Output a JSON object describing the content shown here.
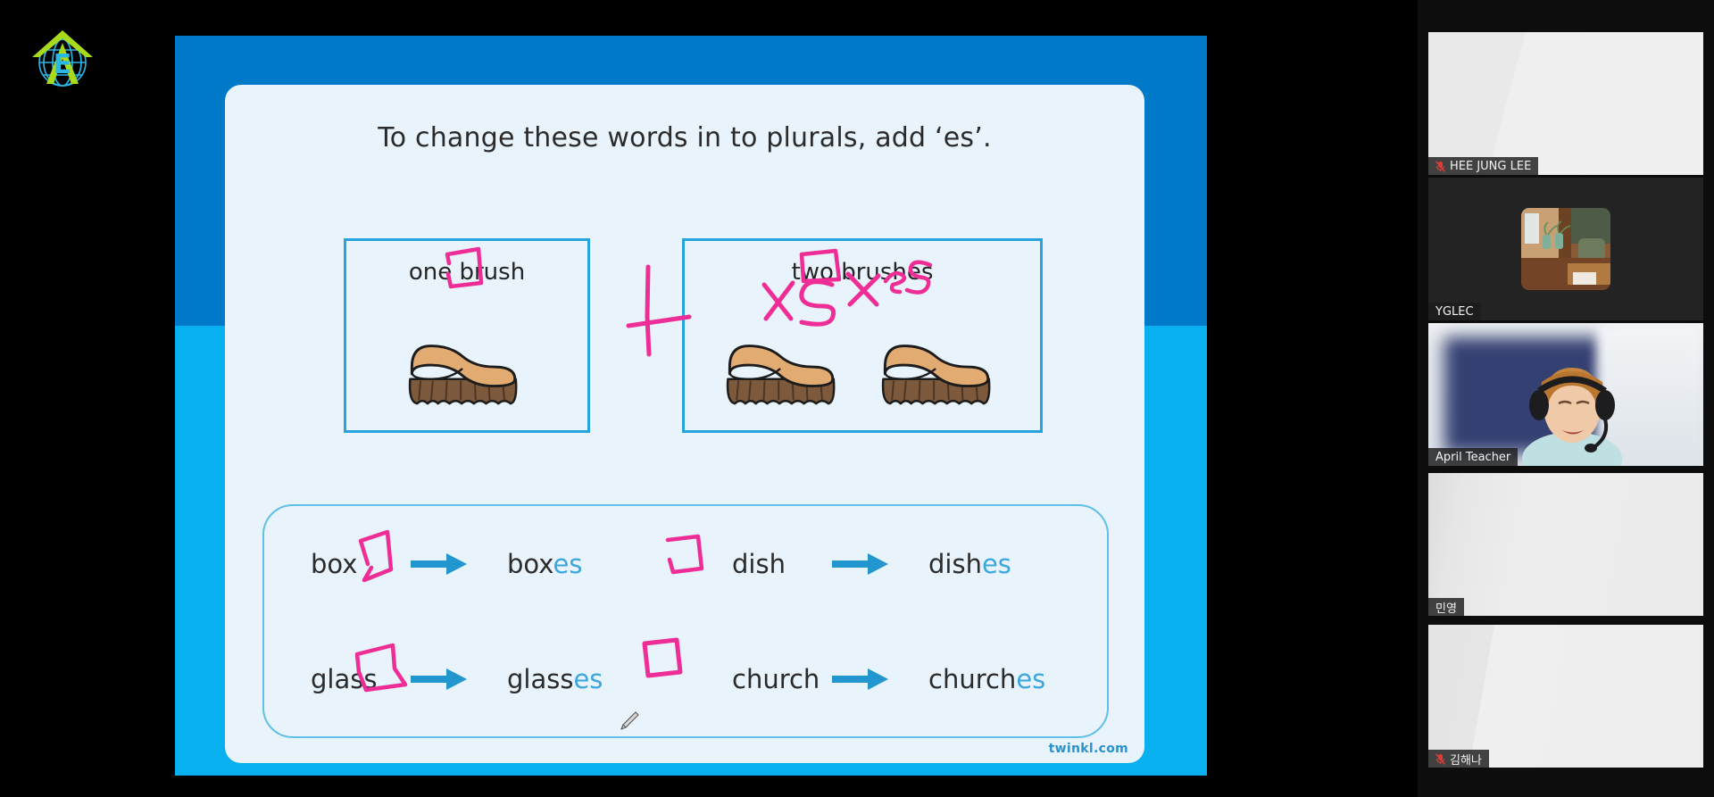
{
  "app": {
    "logo_alt": "globe-arrow-logo",
    "watermark": "twinkl.com"
  },
  "slide": {
    "title": "To change these words in to plurals, add ‘es’.",
    "comparison": [
      {
        "label": "one brush",
        "brush_count": 1
      },
      {
        "label": "two brushes",
        "brush_count": 2
      }
    ],
    "word_pairs": [
      {
        "singular": "box",
        "plural_stem": "box",
        "plural_suffix": "es"
      },
      {
        "singular": "dish",
        "plural_stem": "dish",
        "plural_suffix": "es"
      },
      {
        "singular": "glass",
        "plural_stem": "glass",
        "plural_suffix": "es"
      },
      {
        "singular": "church",
        "plural_stem": "church",
        "plural_suffix": "es"
      }
    ],
    "annotations": {
      "ink_color": "#ee2e96",
      "handwritten": [
        {
          "text": "XS"
        },
        {
          "text": "X es"
        }
      ],
      "marks": [
        "box-around-sh-in-one-brush",
        "box-around-es-in-two-brushes",
        "plus-sign-between-boxes",
        "circle-around-x-in-box",
        "box-around-sh-in-dish",
        "box-around-ss-in-glass",
        "box-around-ch-in-church"
      ]
    },
    "colors": {
      "slide_bg_top": "#0079c8",
      "slide_bg_bottom": "#09b0ef",
      "card_bg": "#e8f3fb",
      "accent_blue": "#27a3dd",
      "suffix_blue": "#3ca6dd"
    }
  },
  "participants": [
    {
      "name": "HEE JUNG LEE",
      "muted": true,
      "speaking": false,
      "has_avatar": false
    },
    {
      "name": "YGLEC",
      "muted": false,
      "speaking": false,
      "has_avatar": true
    },
    {
      "name": "April Teacher",
      "muted": false,
      "speaking": true,
      "has_avatar": false
    },
    {
      "name": "민영",
      "muted": false,
      "speaking": false,
      "has_avatar": false
    },
    {
      "name": "김해나",
      "muted": true,
      "speaking": false,
      "has_avatar": false
    }
  ]
}
